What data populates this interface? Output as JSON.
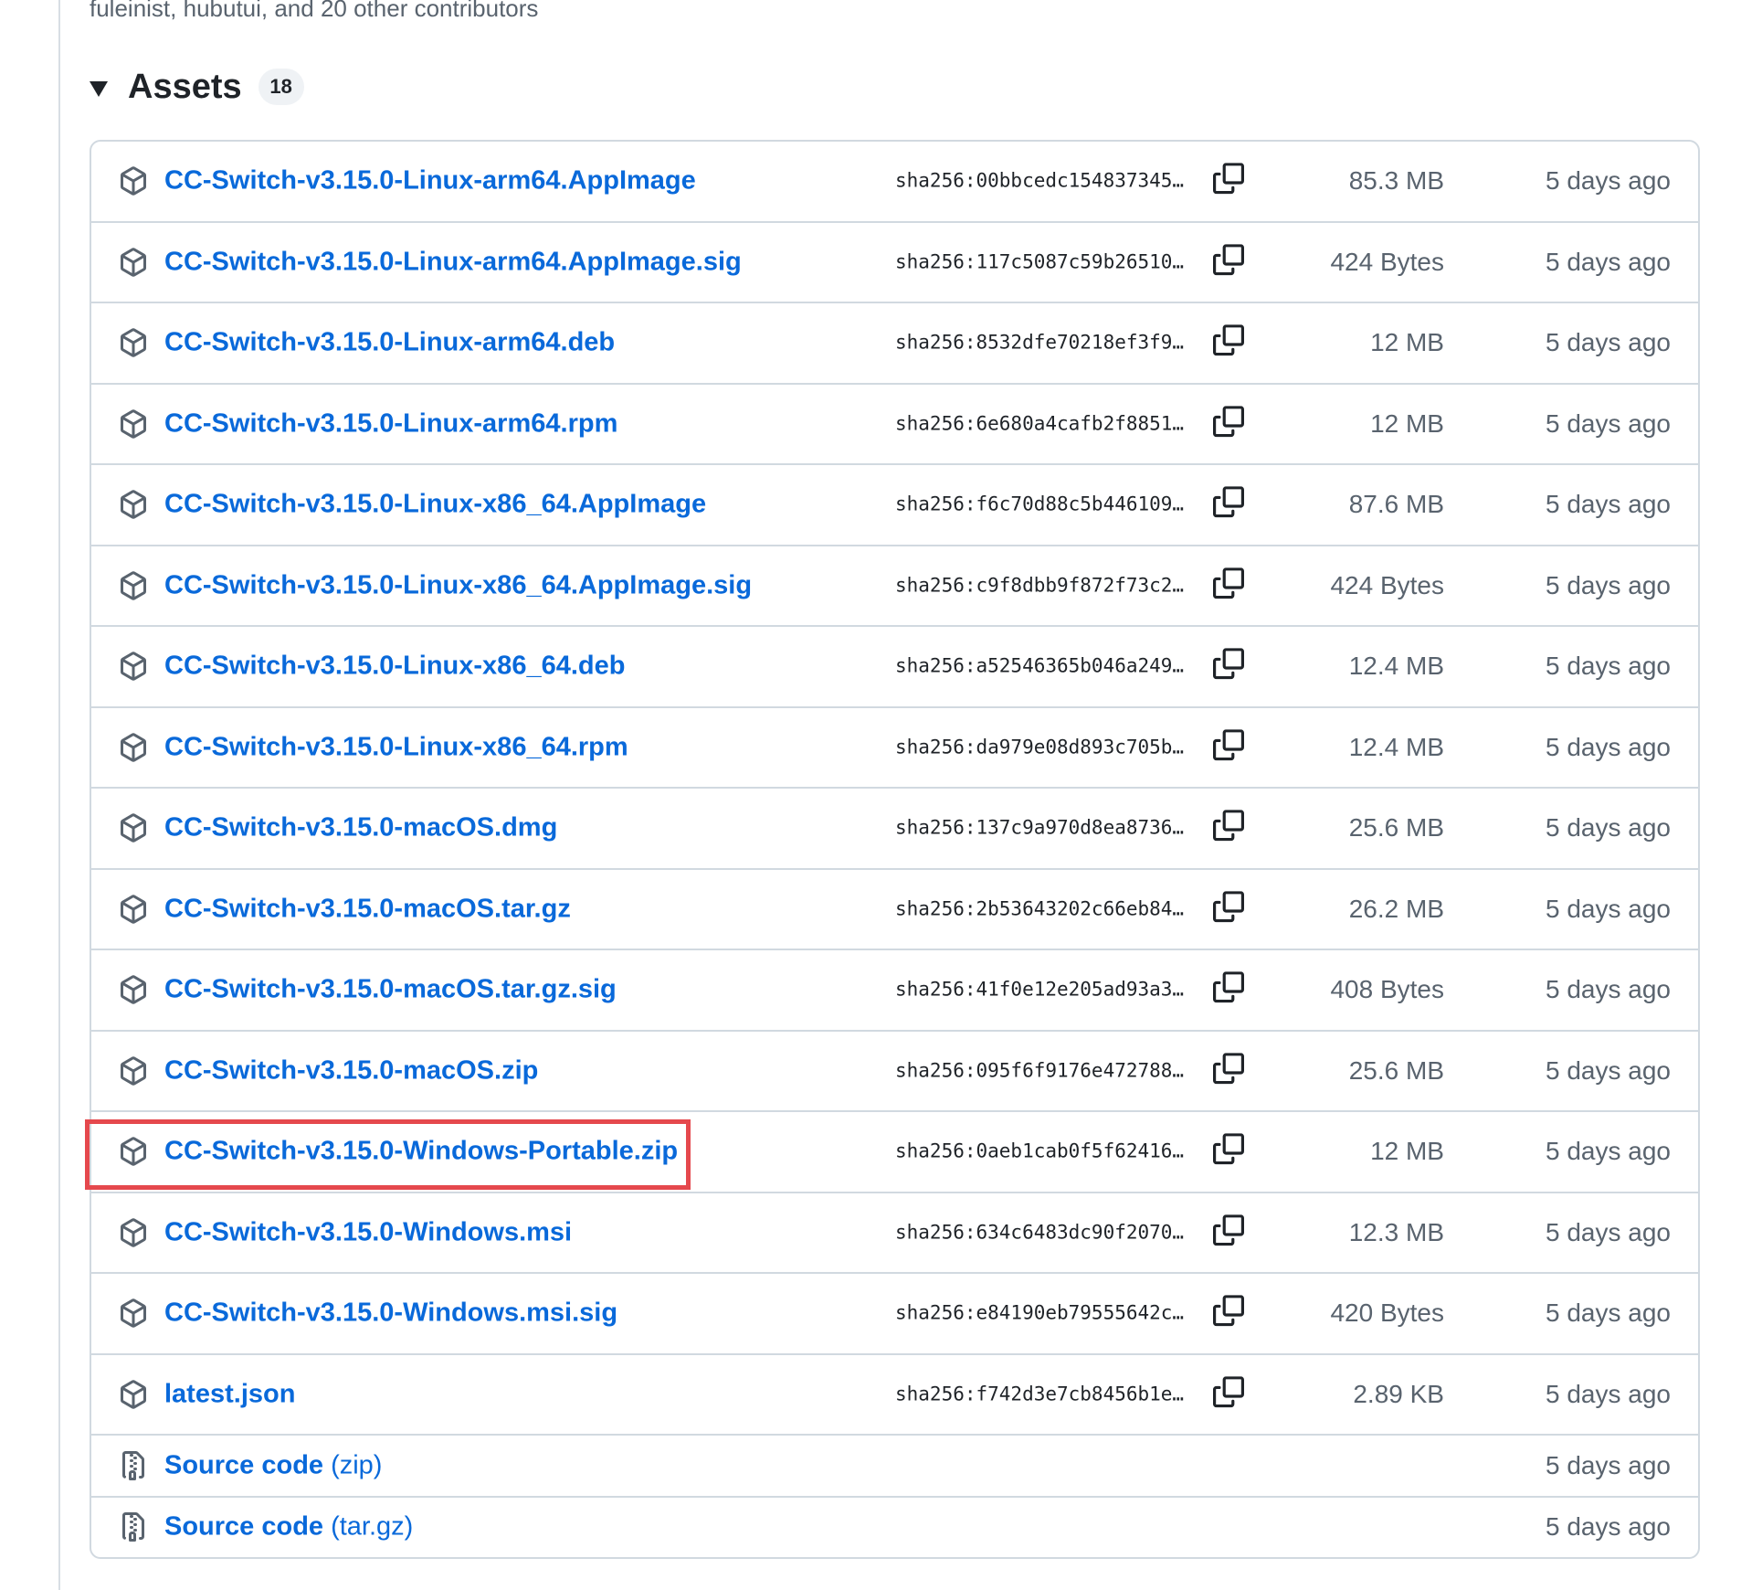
{
  "contributors_text": "fuleinist, hubutui, and 20 other contributors",
  "assets": {
    "title": "Assets",
    "count": "18",
    "rows": [
      {
        "name": "CC-Switch-v3.15.0-Linux-arm64.AppImage",
        "hash": "sha256:00bbcedc154837345…",
        "size": "85.3 MB",
        "date": "5 days ago"
      },
      {
        "name": "CC-Switch-v3.15.0-Linux-arm64.AppImage.sig",
        "hash": "sha256:117c5087c59b26510…",
        "size": "424 Bytes",
        "date": "5 days ago"
      },
      {
        "name": "CC-Switch-v3.15.0-Linux-arm64.deb",
        "hash": "sha256:8532dfe70218ef3f9…",
        "size": "12 MB",
        "date": "5 days ago"
      },
      {
        "name": "CC-Switch-v3.15.0-Linux-arm64.rpm",
        "hash": "sha256:6e680a4cafb2f8851…",
        "size": "12 MB",
        "date": "5 days ago"
      },
      {
        "name": "CC-Switch-v3.15.0-Linux-x86_64.AppImage",
        "hash": "sha256:f6c70d88c5b446109…",
        "size": "87.6 MB",
        "date": "5 days ago"
      },
      {
        "name": "CC-Switch-v3.15.0-Linux-x86_64.AppImage.sig",
        "hash": "sha256:c9f8dbb9f872f73c2…",
        "size": "424 Bytes",
        "date": "5 days ago"
      },
      {
        "name": "CC-Switch-v3.15.0-Linux-x86_64.deb",
        "hash": "sha256:a52546365b046a249…",
        "size": "12.4 MB",
        "date": "5 days ago"
      },
      {
        "name": "CC-Switch-v3.15.0-Linux-x86_64.rpm",
        "hash": "sha256:da979e08d893c705b…",
        "size": "12.4 MB",
        "date": "5 days ago"
      },
      {
        "name": "CC-Switch-v3.15.0-macOS.dmg",
        "hash": "sha256:137c9a970d8ea8736…",
        "size": "25.6 MB",
        "date": "5 days ago"
      },
      {
        "name": "CC-Switch-v3.15.0-macOS.tar.gz",
        "hash": "sha256:2b53643202c66eb84…",
        "size": "26.2 MB",
        "date": "5 days ago"
      },
      {
        "name": "CC-Switch-v3.15.0-macOS.tar.gz.sig",
        "hash": "sha256:41f0e12e205ad93a3…",
        "size": "408 Bytes",
        "date": "5 days ago"
      },
      {
        "name": "CC-Switch-v3.15.0-macOS.zip",
        "hash": "sha256:095f6f9176e472788…",
        "size": "25.6 MB",
        "date": "5 days ago"
      },
      {
        "name": "CC-Switch-v3.15.0-Windows-Portable.zip",
        "hash": "sha256:0aeb1cab0f5f62416…",
        "size": "12 MB",
        "date": "5 days ago"
      },
      {
        "name": "CC-Switch-v3.15.0-Windows.msi",
        "hash": "sha256:634c6483dc90f2070…",
        "size": "12.3 MB",
        "date": "5 days ago"
      },
      {
        "name": "CC-Switch-v3.15.0-Windows.msi.sig",
        "hash": "sha256:e84190eb79555642c…",
        "size": "420 Bytes",
        "date": "5 days ago"
      },
      {
        "name": "latest.json",
        "hash": "sha256:f742d3e7cb8456b1e…",
        "size": "2.89 KB",
        "date": "5 days ago"
      }
    ],
    "source_rows": [
      {
        "name": "Source code",
        "ext": "(zip)",
        "date": "5 days ago"
      },
      {
        "name": "Source code",
        "ext": "(tar.gz)",
        "date": "5 days ago"
      }
    ]
  },
  "icons": {
    "asset": "package-icon",
    "source": "file-zip-icon",
    "copy": "copy-icon",
    "caret": "triangle-down-icon"
  },
  "colors": {
    "link": "#0969da",
    "muted": "#59636e",
    "border": "#d1d9e0",
    "highlight": "#e5484d"
  }
}
